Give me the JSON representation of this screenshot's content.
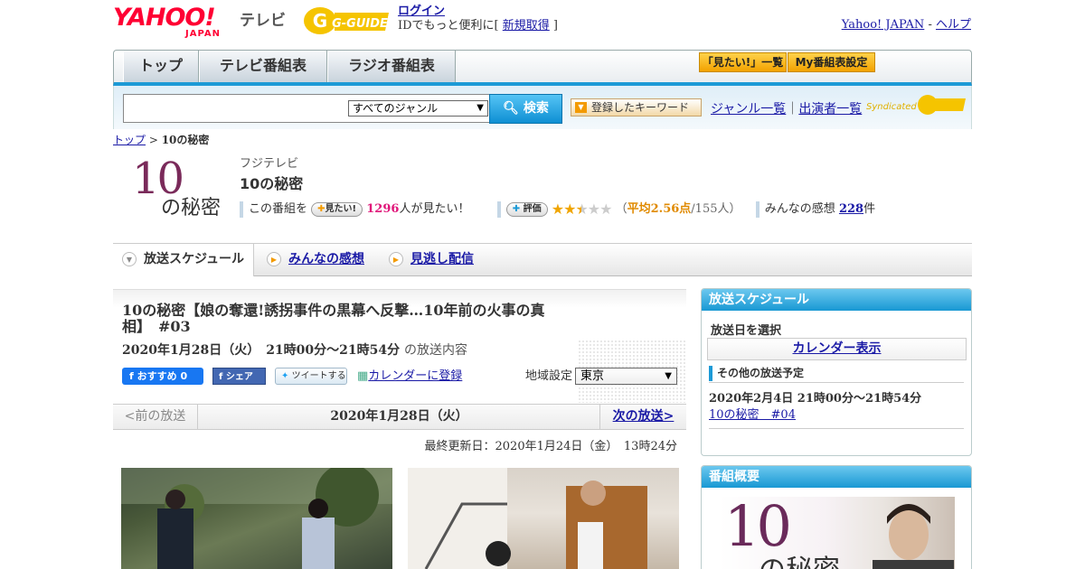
{
  "header": {
    "yahoo_logo": "YAHOO!",
    "yahoo_logo_sub": "JAPAN",
    "terebi": "テレビ",
    "gguide_logo": "G-GUIDE",
    "login_link": "ログイン",
    "login_sub_prefix": "IDでもっと便利に[ ",
    "register_link": "新規取得",
    "login_sub_suffix": " ]",
    "yahoo_japan_link": "Yahoo! JAPAN",
    "separator": " - ",
    "help_link": "ヘルプ"
  },
  "nav": {
    "tabs": [
      "トップ",
      "テレビ番組表",
      "ラジオ番組表"
    ],
    "mitai_list": "「見たい!」一覧",
    "my_schedule": "My番組表設定"
  },
  "search": {
    "genre_selected": "すべてのジャンル",
    "search_button": "検索",
    "keyword_button": "登録したキーワード",
    "genre_list_link": "ジャンル一覧",
    "link_separator": "｜",
    "performer_link": "出演者一覧",
    "syndicated": "Syndicated"
  },
  "breadcrumb": {
    "top": "トップ",
    "sep": " > ",
    "current": "10の秘密"
  },
  "program": {
    "logo_text_1": "10",
    "logo_text_2": "の秘密",
    "station": "フジテレビ",
    "title": "10の秘密",
    "mitai_prefix": "この番組を",
    "mitai_pill": "見たい!",
    "mitai_count": "1296",
    "mitai_suffix": "人が見たい！",
    "rate_pill": "評価",
    "rating_open": "（",
    "rating_avg": "平均2.56点",
    "rating_count": "/155人）",
    "rating_value": 2.56,
    "reviews_prefix": "みんなの感想",
    "reviews_count": "228",
    "reviews_suffix": "件"
  },
  "subtabs": [
    "放送スケジュール",
    "みんなの感想",
    "見逃し配信"
  ],
  "episode": {
    "title": "10の秘密【娘の奪還!誘拐事件の黒幕へ反撃…10年前の火事の真相】　#03",
    "datetime": "2020年1月28日（火）　21時00分～21時54分",
    "datetime_suffix": "の放送内容",
    "fb_like": "おすすめ 0",
    "fb_share": "シェア",
    "tweet": "ツイートする",
    "calendar_register": "カレンダーに登録",
    "region_label": "地域設定",
    "region_value": "東京"
  },
  "pager": {
    "prev": "<前の放送",
    "date": "2020年1月28日（火）",
    "next": "次の放送>"
  },
  "updated": "最終更新日：2020年1月24日（金）　13時24分",
  "sidebar": {
    "schedule_title": "放送スケジュール",
    "date_select": "放送日を選択",
    "calendar_link": "カレンダー表示",
    "other_title": "その他の放送予定",
    "next_datetime": "2020年2月4日  21時00分～21時54分",
    "next_link": "10の秘密　#04",
    "overview_title": "番組概要"
  },
  "colors": {
    "accent_blue": "#1c9ad6",
    "yahoo_red": "#ff0033",
    "mitai_pink": "#e0177a",
    "rating_orange": "#e08a00"
  }
}
